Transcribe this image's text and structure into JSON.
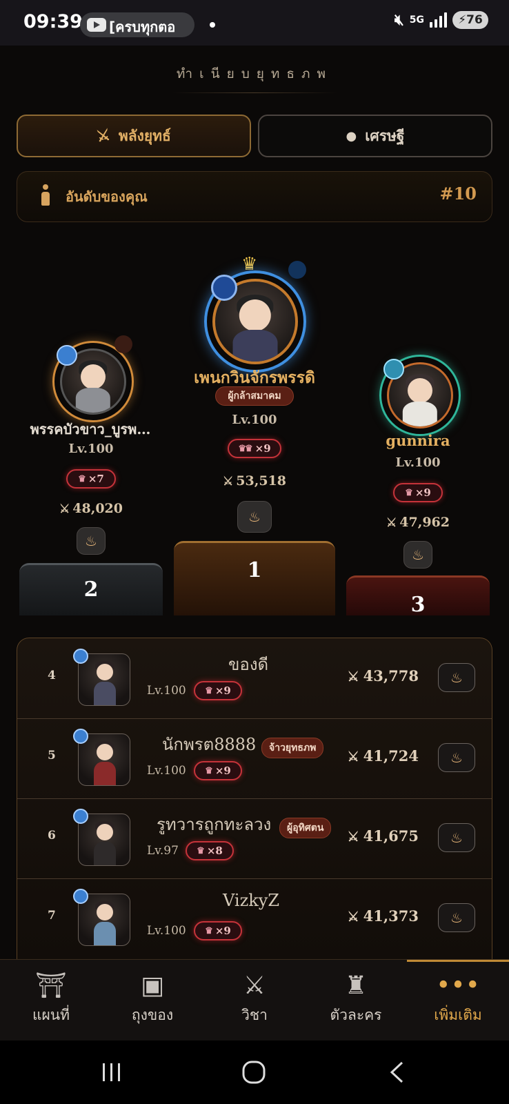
{
  "status_bar": {
    "time": "09:39",
    "notification_text": "[ครบทุกตอ",
    "network": "5G",
    "battery": "76"
  },
  "page": {
    "title": "ทำเนียบยุทธภพ"
  },
  "tabs": [
    {
      "label": "พลังยุทธ์",
      "icon": "sword-slash-icon",
      "active": true
    },
    {
      "label": "เศรษฐี",
      "icon": "coin-icon",
      "active": false
    }
  ],
  "my_rank": {
    "label": "อันดับของคุณ",
    "value": "#10"
  },
  "podium": [
    {
      "rank": "1",
      "name": "เพนกวินจักรพรรดิ",
      "title": "ผู้กล้าสมาคม",
      "level": "Lv.100",
      "crowns": "×9",
      "power": "53,518",
      "ring_color": "#3f8fe0"
    },
    {
      "rank": "2",
      "name": "พรรคบัวขาว_บูรพ…",
      "title": "",
      "level": "Lv.100",
      "crowns": "×7",
      "power": "48,020",
      "ring_color": "#d18b3a"
    },
    {
      "rank": "3",
      "name": "gunnira",
      "title": "",
      "level": "Lv.100",
      "crowns": "×9",
      "power": "47,962",
      "ring_color": "#2fb69a"
    }
  ],
  "ranking_list": [
    {
      "rank": "4",
      "name": "ของดี",
      "title": "",
      "level": "Lv.100",
      "crowns": "×9",
      "power": "43,778"
    },
    {
      "rank": "5",
      "name": "นักพรต8888",
      "title": "จ้าวยุทธภพ",
      "level": "Lv.100",
      "crowns": "×9",
      "power": "41,724"
    },
    {
      "rank": "6",
      "name": "รูทวารถูกทะลวง",
      "title": "ผู้อุทิศตน",
      "level": "Lv.97",
      "crowns": "×8",
      "power": "41,675"
    },
    {
      "rank": "7",
      "name": "VizkyZ",
      "title": "",
      "level": "Lv.100",
      "crowns": "×9",
      "power": "41,373"
    }
  ],
  "bottom_nav": [
    {
      "label": "แผนที่",
      "icon": "pagoda-icon",
      "active": false
    },
    {
      "label": "ถุงของ",
      "icon": "bag-icon",
      "active": false
    },
    {
      "label": "วิชา",
      "icon": "sword-skill-icon",
      "active": false
    },
    {
      "label": "ตัวละคร",
      "icon": "robe-icon",
      "active": false
    },
    {
      "label": "เพิ่มเติม",
      "icon": "more-icon",
      "active": true
    }
  ],
  "colors": {
    "accent": "#e1a84b",
    "crown_chip": "#c5333a",
    "background": "#0b0908"
  }
}
